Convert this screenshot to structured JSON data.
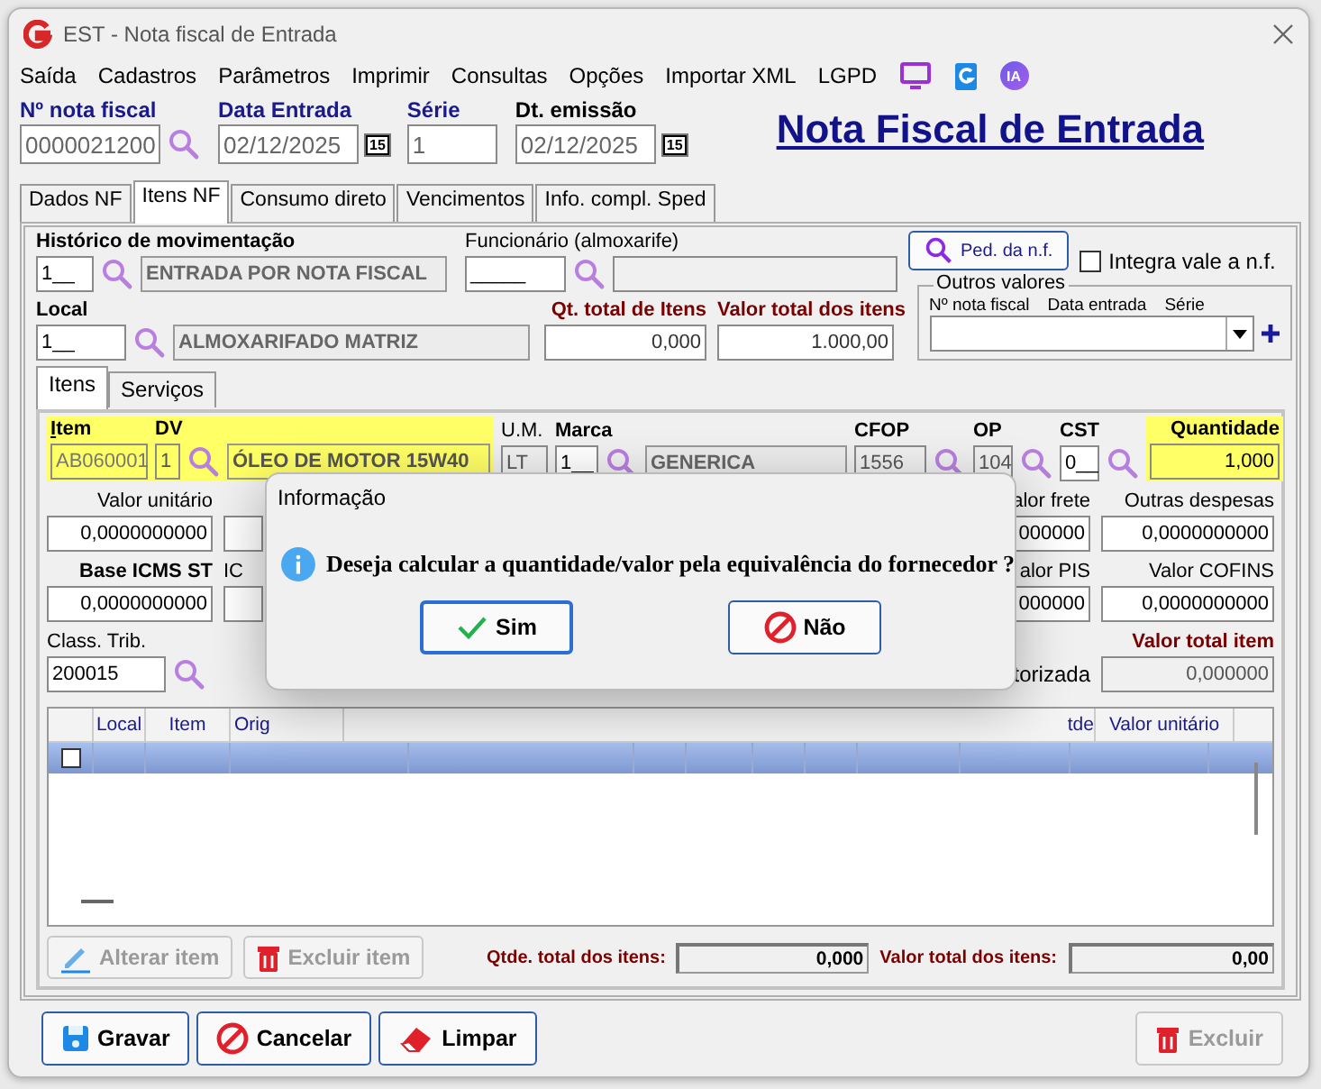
{
  "window": {
    "title": "EST - Nota fiscal de Entrada"
  },
  "menu": [
    "Saída",
    "Cadastros",
    "Parâmetros",
    "Imprimir",
    "Consultas",
    "Opções",
    "Importar XML",
    "LGPD"
  ],
  "menu_badge": "IA",
  "header": {
    "fields": [
      {
        "label": "Nº nota fiscal",
        "value": "0000021200",
        "kind": "search"
      },
      {
        "label": "Data Entrada",
        "value": "02/12/2025",
        "kind": "date",
        "day": "15"
      },
      {
        "label": "Série",
        "value": "1",
        "kind": "plain"
      },
      {
        "label": "Dt. emissão",
        "value": "02/12/2025",
        "kind": "date",
        "day": "15"
      }
    ],
    "title": "Nota Fiscal de Entrada"
  },
  "tabs": [
    {
      "label": "Dados NF",
      "selected": false
    },
    {
      "label": "Itens NF",
      "selected": true
    },
    {
      "label": "Consumo direto",
      "selected": false
    },
    {
      "label": "Vencimentos",
      "selected": false
    },
    {
      "label": "Info. compl. Sped",
      "selected": false
    }
  ],
  "movement": {
    "label": "Histórico de movimentação",
    "code": "1__",
    "description": "ENTRADA POR NOTA FISCAL"
  },
  "employee": {
    "label": "Funcionário (almoxarife)",
    "code": "_____"
  },
  "order_button": {
    "label": "Ped. da n.f."
  },
  "integrate": {
    "label": "Integra vale a n.f.",
    "checked": false
  },
  "local": {
    "label": "Local",
    "code": "1__",
    "description": "ALMOXARIFADO MATRIZ"
  },
  "totals": [
    {
      "label": "Qt. total de Itens",
      "value": "0,000"
    },
    {
      "label": "Valor total dos itens",
      "value": "1.000,00"
    }
  ],
  "other_values": {
    "title": "Outros valores",
    "columns": [
      "Nº nota fiscal",
      "Data entrada",
      "Série"
    ]
  },
  "inner_tabs": [
    {
      "label": "Itens",
      "selected": true
    },
    {
      "label": "Serviços",
      "selected": false
    }
  ],
  "item": {
    "highlighted": true,
    "item_label": "Item",
    "item_value": "AB060001",
    "dv_label": "DV",
    "dv_value": "1",
    "description": "ÓLEO DE MOTOR 15W40",
    "um_label": "U.M.",
    "um_value": "LT",
    "brand_label": "Marca",
    "brand_code": "1__",
    "brand_name": "GENERICA",
    "cfop_label": "CFOP",
    "cfop_value": "1556",
    "op_label": "OP",
    "op_value": "104",
    "cst_label": "CST",
    "cst_value": "0__",
    "qty_label": "Quantidade",
    "qty_value": "1,000"
  },
  "values_rows": [
    {
      "left_label": "Valor unitário",
      "left_value": "0,0000000000",
      "mid_label": "alor frete",
      "mid_value": "000000",
      "right_label": "Outras despesas",
      "right_value": "0,0000000000"
    },
    {
      "left_label": "Base ICMS ST",
      "left_value": "0,0000000000",
      "stub_label": "IC",
      "mid_label": "alor PIS",
      "mid_value": "000000",
      "right_label": "Valor COFINS",
      "right_value": "0,0000000000"
    }
  ],
  "class_row": {
    "label": "Class. Trib.",
    "value": "200015",
    "mid_label": "torizada",
    "right_label": "Valor total item",
    "right_value": "0,000000"
  },
  "grid": {
    "columns": [
      "Local",
      "Item",
      "Orig",
      "tde",
      "Valor unitário"
    ],
    "rows": [
      {
        "checked": false,
        "selected": true
      }
    ]
  },
  "item_buttons": [
    {
      "label": "Alterar item",
      "disabled": true,
      "kind": "edit"
    },
    {
      "label": "Excluir item",
      "disabled": true,
      "kind": "delete"
    }
  ],
  "item_totals": [
    {
      "label": "Qtde. total dos itens:",
      "value": "0,000"
    },
    {
      "label": "Valor total dos itens:",
      "value": "0,00"
    }
  ],
  "footer_buttons": [
    {
      "label": "Gravar",
      "disabled": false,
      "kind": "save"
    },
    {
      "label": "Cancelar",
      "disabled": false,
      "kind": "cancel"
    },
    {
      "label": "Limpar",
      "disabled": false,
      "kind": "clear"
    },
    {
      "label": "Excluir",
      "disabled": true,
      "kind": "delete"
    }
  ],
  "dialog": {
    "title": "Informação",
    "message": "Deseja calcular a quantidade/valor pela equivalência do fornecedor ?",
    "buttons": [
      {
        "label": "Sim",
        "kind": "yes",
        "selected": true
      },
      {
        "label": "Não",
        "kind": "no",
        "selected": false
      }
    ]
  }
}
